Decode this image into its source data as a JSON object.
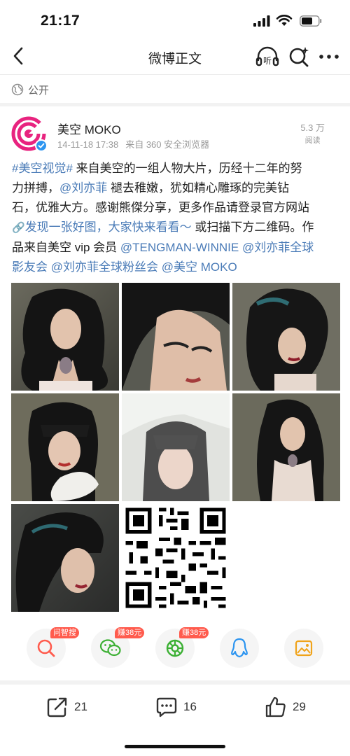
{
  "status_bar": {
    "time": "21:17"
  },
  "nav": {
    "title": "微博正文",
    "listen_label": "听"
  },
  "visibility": {
    "label": "公开"
  },
  "author": {
    "name": "美空 MOKO",
    "date": "14-11-18 17:38",
    "source": "来自 360 安全浏览器"
  },
  "views": {
    "count": "5.3 万",
    "label": "阅读"
  },
  "post": {
    "lines": [
      [
        {
          "t": "#美空视觉#",
          "link": true
        },
        {
          "t": " 来自美空的一组人物大片，历经十二年的努"
        }
      ],
      [
        {
          "t": "力拼搏，"
        },
        {
          "t": "@刘亦菲",
          "link": true
        },
        {
          "t": " 褪去稚嫩，犹如精心雕琢的完美钻"
        }
      ],
      [
        {
          "t": "石，优雅大方。感谢熊傑分享，更多作品请登录官方网站"
        }
      ],
      [
        {
          "t": "🔗",
          "link": true,
          "icon": true
        },
        {
          "t": "发现一张好图，大家快来看看～",
          "link": true
        },
        {
          "t": " 或扫描下方二维码。作"
        }
      ],
      [
        {
          "t": "品来自美空 vip 会员 "
        },
        {
          "t": "@TENGMAN-WINNIE",
          "link": true
        },
        {
          "t": " "
        },
        {
          "t": "@刘亦菲全球",
          "link": true
        }
      ],
      [
        {
          "t": "影友会",
          "link": true
        },
        {
          "t": " "
        },
        {
          "t": "@刘亦菲全球粉丝会",
          "link": true
        },
        {
          "t": " "
        },
        {
          "t": "@美空 MOKO",
          "link": true
        }
      ]
    ]
  },
  "share": [
    {
      "name": "search",
      "badge": "问智搜"
    },
    {
      "name": "wechat",
      "badge": "赚38元"
    },
    {
      "name": "moments",
      "badge": "赚38元"
    },
    {
      "name": "qq",
      "badge": ""
    },
    {
      "name": "save-image",
      "badge": ""
    }
  ],
  "actions": {
    "repost": "21",
    "comment": "16",
    "like": "29"
  },
  "colors": {
    "link": "#4a7bb7",
    "badge": "#ff5b4d",
    "brand_pink": "#e8237f",
    "verified": "#2d95f0"
  }
}
